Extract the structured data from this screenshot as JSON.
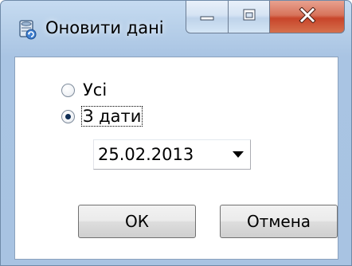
{
  "window": {
    "title": "Оновити дані",
    "icon": "refresh-data-icon"
  },
  "caption_buttons": {
    "minimize": "minimize-icon",
    "maximize": "maximize-icon",
    "close": "close-icon"
  },
  "options": {
    "all_label": "Усі",
    "from_date_label": "З дати",
    "selected": "from_date"
  },
  "date_picker": {
    "value": "25.02.2013"
  },
  "buttons": {
    "ok_label": "ОК",
    "cancel_label": "Отмена"
  },
  "colors": {
    "frame": "#a9c4e3",
    "close_button": "#c8452a"
  }
}
